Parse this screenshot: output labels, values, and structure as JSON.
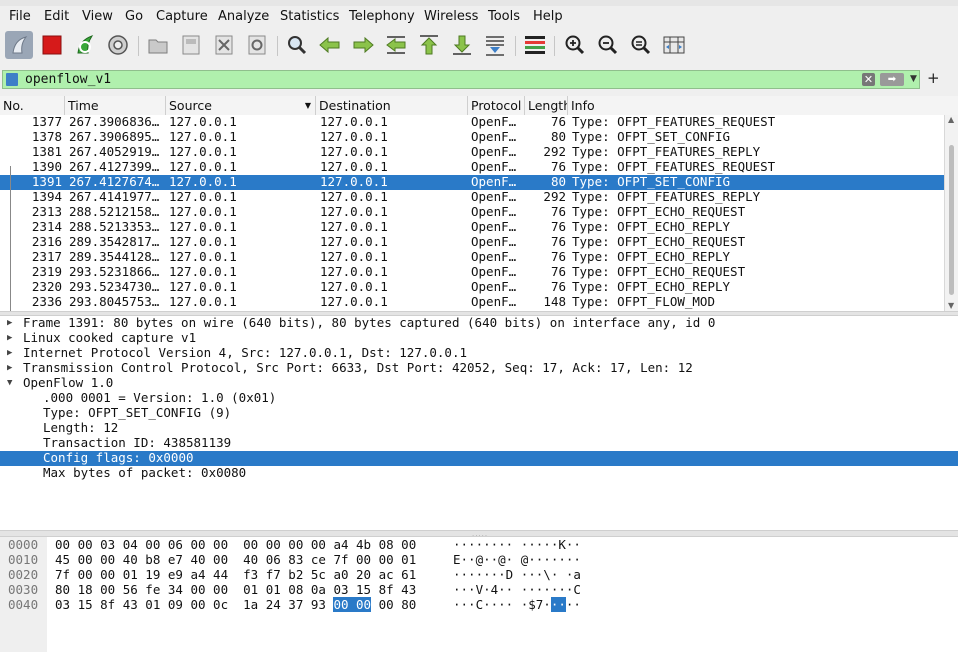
{
  "menu": [
    "File",
    "Edit",
    "View",
    "Go",
    "Capture",
    "Analyze",
    "Statistics",
    "Telephony",
    "Wireless",
    "Tools",
    "Help"
  ],
  "toolbar_icons": [
    "shark-fin-start-icon",
    "stop-capture-icon",
    "restart-capture-icon",
    "capture-options-icon",
    "open-file-icon",
    "save-file-icon",
    "close-file-icon",
    "reload-file-icon",
    "find-packet-icon",
    "go-back-icon",
    "go-forward-icon",
    "go-to-packet-icon",
    "go-first-icon",
    "go-last-icon",
    "autoscroll-icon",
    "colorize-icon",
    "zoom-in-icon",
    "zoom-out-icon",
    "zoom-normal-icon",
    "resize-columns-icon"
  ],
  "filter": {
    "value": "openflow_v1"
  },
  "columns": [
    "No.",
    "Time",
    "Source",
    "Destination",
    "Protocol",
    "Length",
    "Info"
  ],
  "packets": [
    {
      "no": "1377",
      "time": "267.3906836…",
      "src": "127.0.0.1",
      "dst": "127.0.0.1",
      "proto": "OpenF…",
      "len": "76",
      "info": "Type: OFPT_FEATURES_REQUEST"
    },
    {
      "no": "1378",
      "time": "267.3906895…",
      "src": "127.0.0.1",
      "dst": "127.0.0.1",
      "proto": "OpenF…",
      "len": "80",
      "info": "Type: OFPT_SET_CONFIG"
    },
    {
      "no": "1381",
      "time": "267.4052919…",
      "src": "127.0.0.1",
      "dst": "127.0.0.1",
      "proto": "OpenF…",
      "len": "292",
      "info": "Type: OFPT_FEATURES_REPLY"
    },
    {
      "no": "1390",
      "time": "267.4127399…",
      "src": "127.0.0.1",
      "dst": "127.0.0.1",
      "proto": "OpenF…",
      "len": "76",
      "info": "Type: OFPT_FEATURES_REQUEST"
    },
    {
      "no": "1391",
      "time": "267.4127674…",
      "src": "127.0.0.1",
      "dst": "127.0.0.1",
      "proto": "OpenF…",
      "len": "80",
      "info": "Type: OFPT_SET_CONFIG",
      "selected": true
    },
    {
      "no": "1394",
      "time": "267.4141977…",
      "src": "127.0.0.1",
      "dst": "127.0.0.1",
      "proto": "OpenF…",
      "len": "292",
      "info": "Type: OFPT_FEATURES_REPLY"
    },
    {
      "no": "2313",
      "time": "288.5212158…",
      "src": "127.0.0.1",
      "dst": "127.0.0.1",
      "proto": "OpenF…",
      "len": "76",
      "info": "Type: OFPT_ECHO_REQUEST"
    },
    {
      "no": "2314",
      "time": "288.5213353…",
      "src": "127.0.0.1",
      "dst": "127.0.0.1",
      "proto": "OpenF…",
      "len": "76",
      "info": "Type: OFPT_ECHO_REPLY"
    },
    {
      "no": "2316",
      "time": "289.3542817…",
      "src": "127.0.0.1",
      "dst": "127.0.0.1",
      "proto": "OpenF…",
      "len": "76",
      "info": "Type: OFPT_ECHO_REQUEST"
    },
    {
      "no": "2317",
      "time": "289.3544128…",
      "src": "127.0.0.1",
      "dst": "127.0.0.1",
      "proto": "OpenF…",
      "len": "76",
      "info": "Type: OFPT_ECHO_REPLY"
    },
    {
      "no": "2319",
      "time": "293.5231866…",
      "src": "127.0.0.1",
      "dst": "127.0.0.1",
      "proto": "OpenF…",
      "len": "76",
      "info": "Type: OFPT_ECHO_REQUEST"
    },
    {
      "no": "2320",
      "time": "293.5234730…",
      "src": "127.0.0.1",
      "dst": "127.0.0.1",
      "proto": "OpenF…",
      "len": "76",
      "info": "Type: OFPT_ECHO_REPLY"
    },
    {
      "no": "2336",
      "time": "293.8045753…",
      "src": "127.0.0.1",
      "dst": "127.0.0.1",
      "proto": "OpenF…",
      "len": "148",
      "info": "Type: OFPT_FLOW_MOD"
    }
  ],
  "details": [
    {
      "text": "Frame 1391: 80 bytes on wire (640 bits), 80 bytes captured (640 bits) on interface any, id 0",
      "level": 0,
      "expander": "collapsed"
    },
    {
      "text": "Linux cooked capture v1",
      "level": 0,
      "expander": "collapsed"
    },
    {
      "text": "Internet Protocol Version 4, Src: 127.0.0.1, Dst: 127.0.0.1",
      "level": 0,
      "expander": "collapsed"
    },
    {
      "text": "Transmission Control Protocol, Src Port: 6633, Dst Port: 42052, Seq: 17, Ack: 17, Len: 12",
      "level": 0,
      "expander": "collapsed"
    },
    {
      "text": "OpenFlow 1.0",
      "level": 0,
      "expander": "expanded"
    },
    {
      "text": ".000 0001 = Version: 1.0 (0x01)",
      "level": 1,
      "expander": "none"
    },
    {
      "text": "Type: OFPT_SET_CONFIG (9)",
      "level": 1,
      "expander": "none"
    },
    {
      "text": "Length: 12",
      "level": 1,
      "expander": "none"
    },
    {
      "text": "Transaction ID: 438581139",
      "level": 1,
      "expander": "none"
    },
    {
      "text": "Config flags: 0x0000",
      "level": 1,
      "expander": "none",
      "selected": true
    },
    {
      "text": "Max bytes of packet: 0x0080",
      "level": 1,
      "expander": "none"
    }
  ],
  "bytes": [
    {
      "offset": "0000",
      "hex_pre": "00 00 03 04 00 06 00 00  00 00 00 00 a4 4b 08 00",
      "hex_hl": "",
      "hex_post": "",
      "ascii_pre": "········ ·····K··",
      "ascii_hl": "",
      "ascii_post": ""
    },
    {
      "offset": "0010",
      "hex_pre": "45 00 00 40 b8 e7 40 00  40 06 83 ce 7f 00 00 01",
      "hex_hl": "",
      "hex_post": "",
      "ascii_pre": "E··@··@· @·······",
      "ascii_hl": "",
      "ascii_post": ""
    },
    {
      "offset": "0020",
      "hex_pre": "7f 00 00 01 19 e9 a4 44  f3 f7 b2 5c a0 20 ac 61",
      "hex_hl": "",
      "hex_post": "",
      "ascii_pre": "·······D ···\\· ·a",
      "ascii_hl": "",
      "ascii_post": ""
    },
    {
      "offset": "0030",
      "hex_pre": "80 18 00 56 fe 34 00 00  01 01 08 0a 03 15 8f 43",
      "hex_hl": "",
      "hex_post": "",
      "ascii_pre": "···V·4·· ·······C",
      "ascii_hl": "",
      "ascii_post": ""
    },
    {
      "offset": "0040",
      "hex_pre": "03 15 8f 43 01 09 00 0c  1a 24 37 93 ",
      "hex_hl": "00 00",
      "hex_post": " 00 80",
      "ascii_pre": "···C···· ·$7·",
      "ascii_hl": "··",
      "ascii_post": "··"
    }
  ],
  "colors": {
    "selection": "#2a7ac8",
    "filter_ok": "#b0f0ad"
  }
}
